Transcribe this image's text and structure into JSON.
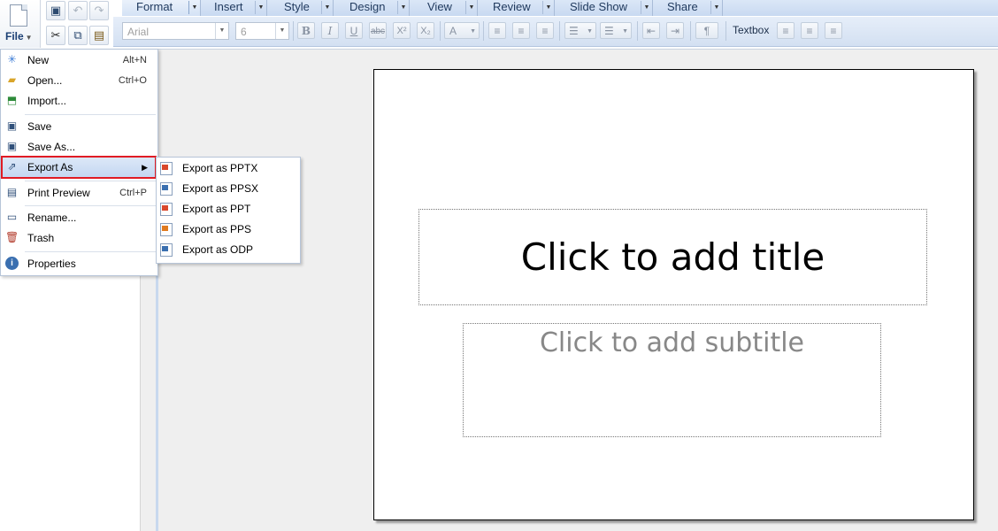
{
  "toolbar": {
    "file_label": "File",
    "tabs": [
      "Format",
      "Insert",
      "Style",
      "Design",
      "View",
      "Review",
      "Slide Show",
      "Share"
    ],
    "font_name": "Arial",
    "font_size": "6",
    "textbox_label": "Textbox"
  },
  "file_menu": {
    "items": [
      {
        "label": "New",
        "shortcut": "Alt+N",
        "icon": "new-icon"
      },
      {
        "label": "Open...",
        "shortcut": "Ctrl+O",
        "icon": "open-folder-icon"
      },
      {
        "label": "Import...",
        "shortcut": "",
        "icon": "import-icon"
      },
      {
        "label": "Save",
        "shortcut": "",
        "icon": "save-icon"
      },
      {
        "label": "Save As...",
        "shortcut": "",
        "icon": "save-as-icon"
      },
      {
        "label": "Export As",
        "shortcut": "",
        "icon": "export-icon",
        "highlighted": true
      },
      {
        "label": "Print Preview",
        "shortcut": "Ctrl+P",
        "icon": "print-preview-icon"
      },
      {
        "label": "Rename...",
        "shortcut": "",
        "icon": "rename-icon"
      },
      {
        "label": "Trash",
        "shortcut": "",
        "icon": "trash-icon"
      },
      {
        "label": "Properties",
        "shortcut": "",
        "icon": "info-icon"
      }
    ]
  },
  "export_submenu": {
    "items": [
      {
        "label": "Export as PPTX",
        "color": "#d9472b"
      },
      {
        "label": "Export as PPSX",
        "color": "#3a6fb0"
      },
      {
        "label": "Export as PPT",
        "color": "#d9472b"
      },
      {
        "label": "Export as PPS",
        "color": "#e07a1f"
      },
      {
        "label": "Export as ODP",
        "color": "#3a6fb0"
      }
    ]
  },
  "slide": {
    "title_placeholder": "Click to add title",
    "subtitle_placeholder": "Click to add subtitle"
  }
}
